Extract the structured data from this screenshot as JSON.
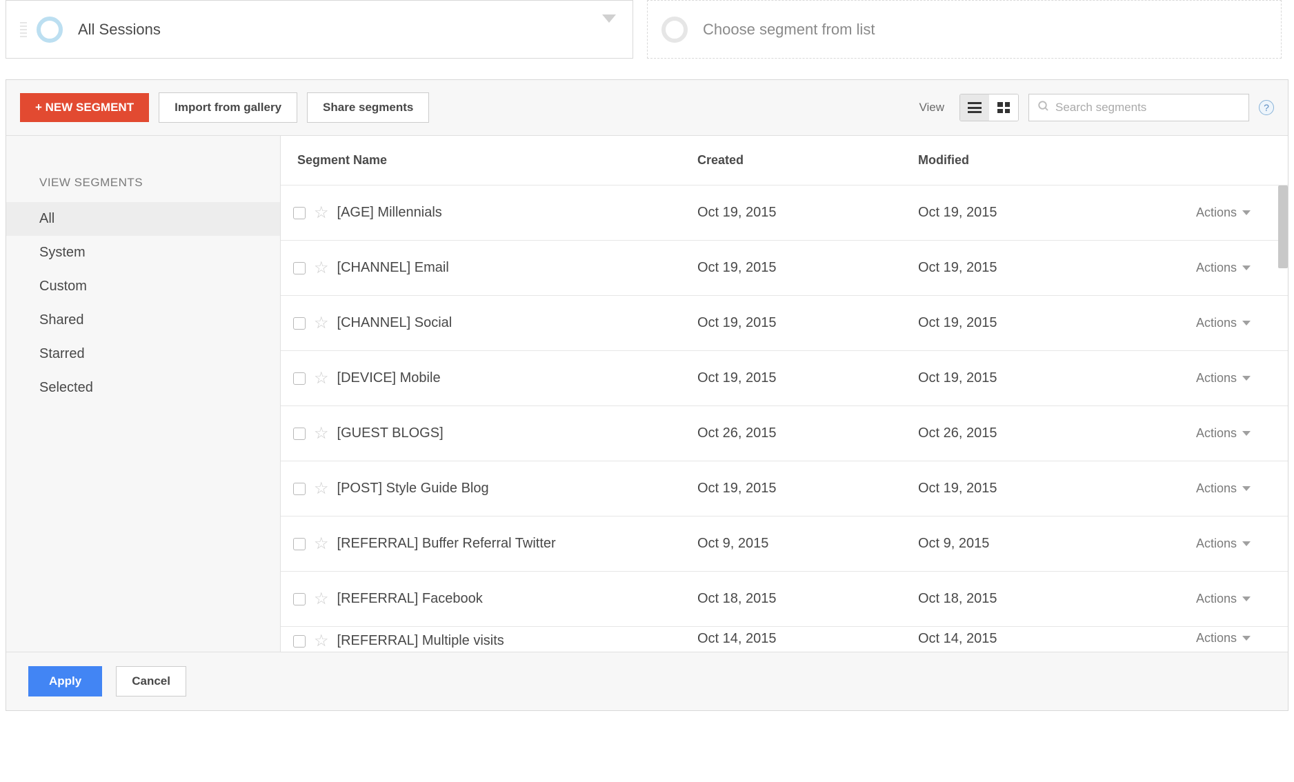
{
  "topSegments": {
    "active": {
      "label": "All Sessions"
    },
    "placeholder": {
      "label": "Choose segment from list"
    }
  },
  "toolbar": {
    "newSegment": "+ NEW SEGMENT",
    "importGallery": "Import from gallery",
    "shareSegments": "Share segments",
    "viewLabel": "View",
    "searchPlaceholder": "Search segments"
  },
  "sidebar": {
    "header": "VIEW SEGMENTS",
    "items": [
      {
        "label": "All",
        "active": true
      },
      {
        "label": "System"
      },
      {
        "label": "Custom"
      },
      {
        "label": "Shared"
      },
      {
        "label": "Starred"
      },
      {
        "label": "Selected"
      }
    ]
  },
  "table": {
    "headers": {
      "name": "Segment Name",
      "created": "Created",
      "modified": "Modified"
    },
    "actionLabel": "Actions",
    "rows": [
      {
        "name": "[AGE] Millennials",
        "created": "Oct 19, 2015",
        "modified": "Oct 19, 2015"
      },
      {
        "name": "[CHANNEL] Email",
        "created": "Oct 19, 2015",
        "modified": "Oct 19, 2015"
      },
      {
        "name": "[CHANNEL] Social",
        "created": "Oct 19, 2015",
        "modified": "Oct 19, 2015"
      },
      {
        "name": "[DEVICE] Mobile",
        "created": "Oct 19, 2015",
        "modified": "Oct 19, 2015"
      },
      {
        "name": "[GUEST BLOGS]",
        "created": "Oct 26, 2015",
        "modified": "Oct 26, 2015"
      },
      {
        "name": "[POST] Style Guide Blog",
        "created": "Oct 19, 2015",
        "modified": "Oct 19, 2015"
      },
      {
        "name": "[REFERRAL] Buffer Referral Twitter",
        "created": "Oct 9, 2015",
        "modified": "Oct 9, 2015"
      },
      {
        "name": "[REFERRAL] Facebook",
        "created": "Oct 18, 2015",
        "modified": "Oct 18, 2015"
      },
      {
        "name": "[REFERRAL] Multiple visits",
        "created": "Oct 14, 2015",
        "modified": "Oct 14, 2015"
      }
    ]
  },
  "footer": {
    "apply": "Apply",
    "cancel": "Cancel"
  }
}
